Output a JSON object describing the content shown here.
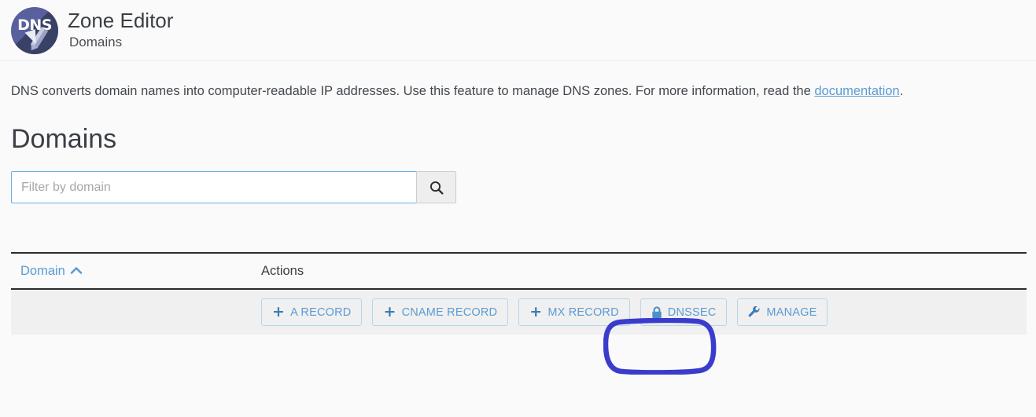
{
  "header": {
    "logo_icon": "dns-logo-icon",
    "logo_text": "DNS",
    "title": "Zone Editor",
    "subtitle": "Domains"
  },
  "description": {
    "text_before": "DNS converts domain names into computer-readable IP addresses. Use this feature to manage DNS zones. For more information, read the ",
    "link_label": "documentation",
    "text_after": "."
  },
  "section": {
    "title": "Domains"
  },
  "filter": {
    "placeholder": "Filter by domain",
    "value": "",
    "search_icon": "search-icon"
  },
  "table": {
    "columns": [
      {
        "label": "Domain",
        "sortable": true,
        "sort_icon": "chevron-up-icon",
        "sort_direction": "ascending"
      },
      {
        "label": "Actions",
        "sortable": false
      }
    ],
    "rows": [
      {
        "domain": "",
        "actions": [
          {
            "label": "A RECORD",
            "icon": "plus-icon"
          },
          {
            "label": "CNAME RECORD",
            "icon": "plus-icon"
          },
          {
            "label": "MX RECORD",
            "icon": "plus-icon"
          },
          {
            "label": "DNSSEC",
            "icon": "lock-icon"
          },
          {
            "label": "MANAGE",
            "icon": "wrench-icon"
          }
        ]
      }
    ]
  },
  "annotation": {
    "target": "DNSSEC",
    "shape": "rounded-rectangle-highlight",
    "color": "#3a3ccc"
  },
  "colors": {
    "page_background": "#fafafa",
    "link_blue": "#5b9bd5",
    "button_blue": "#5b9bd5",
    "row_background": "#f0f0f0",
    "table_border": "#2b2b2b",
    "input_border": "#66afe9",
    "annotation": "#3a3ccc"
  }
}
